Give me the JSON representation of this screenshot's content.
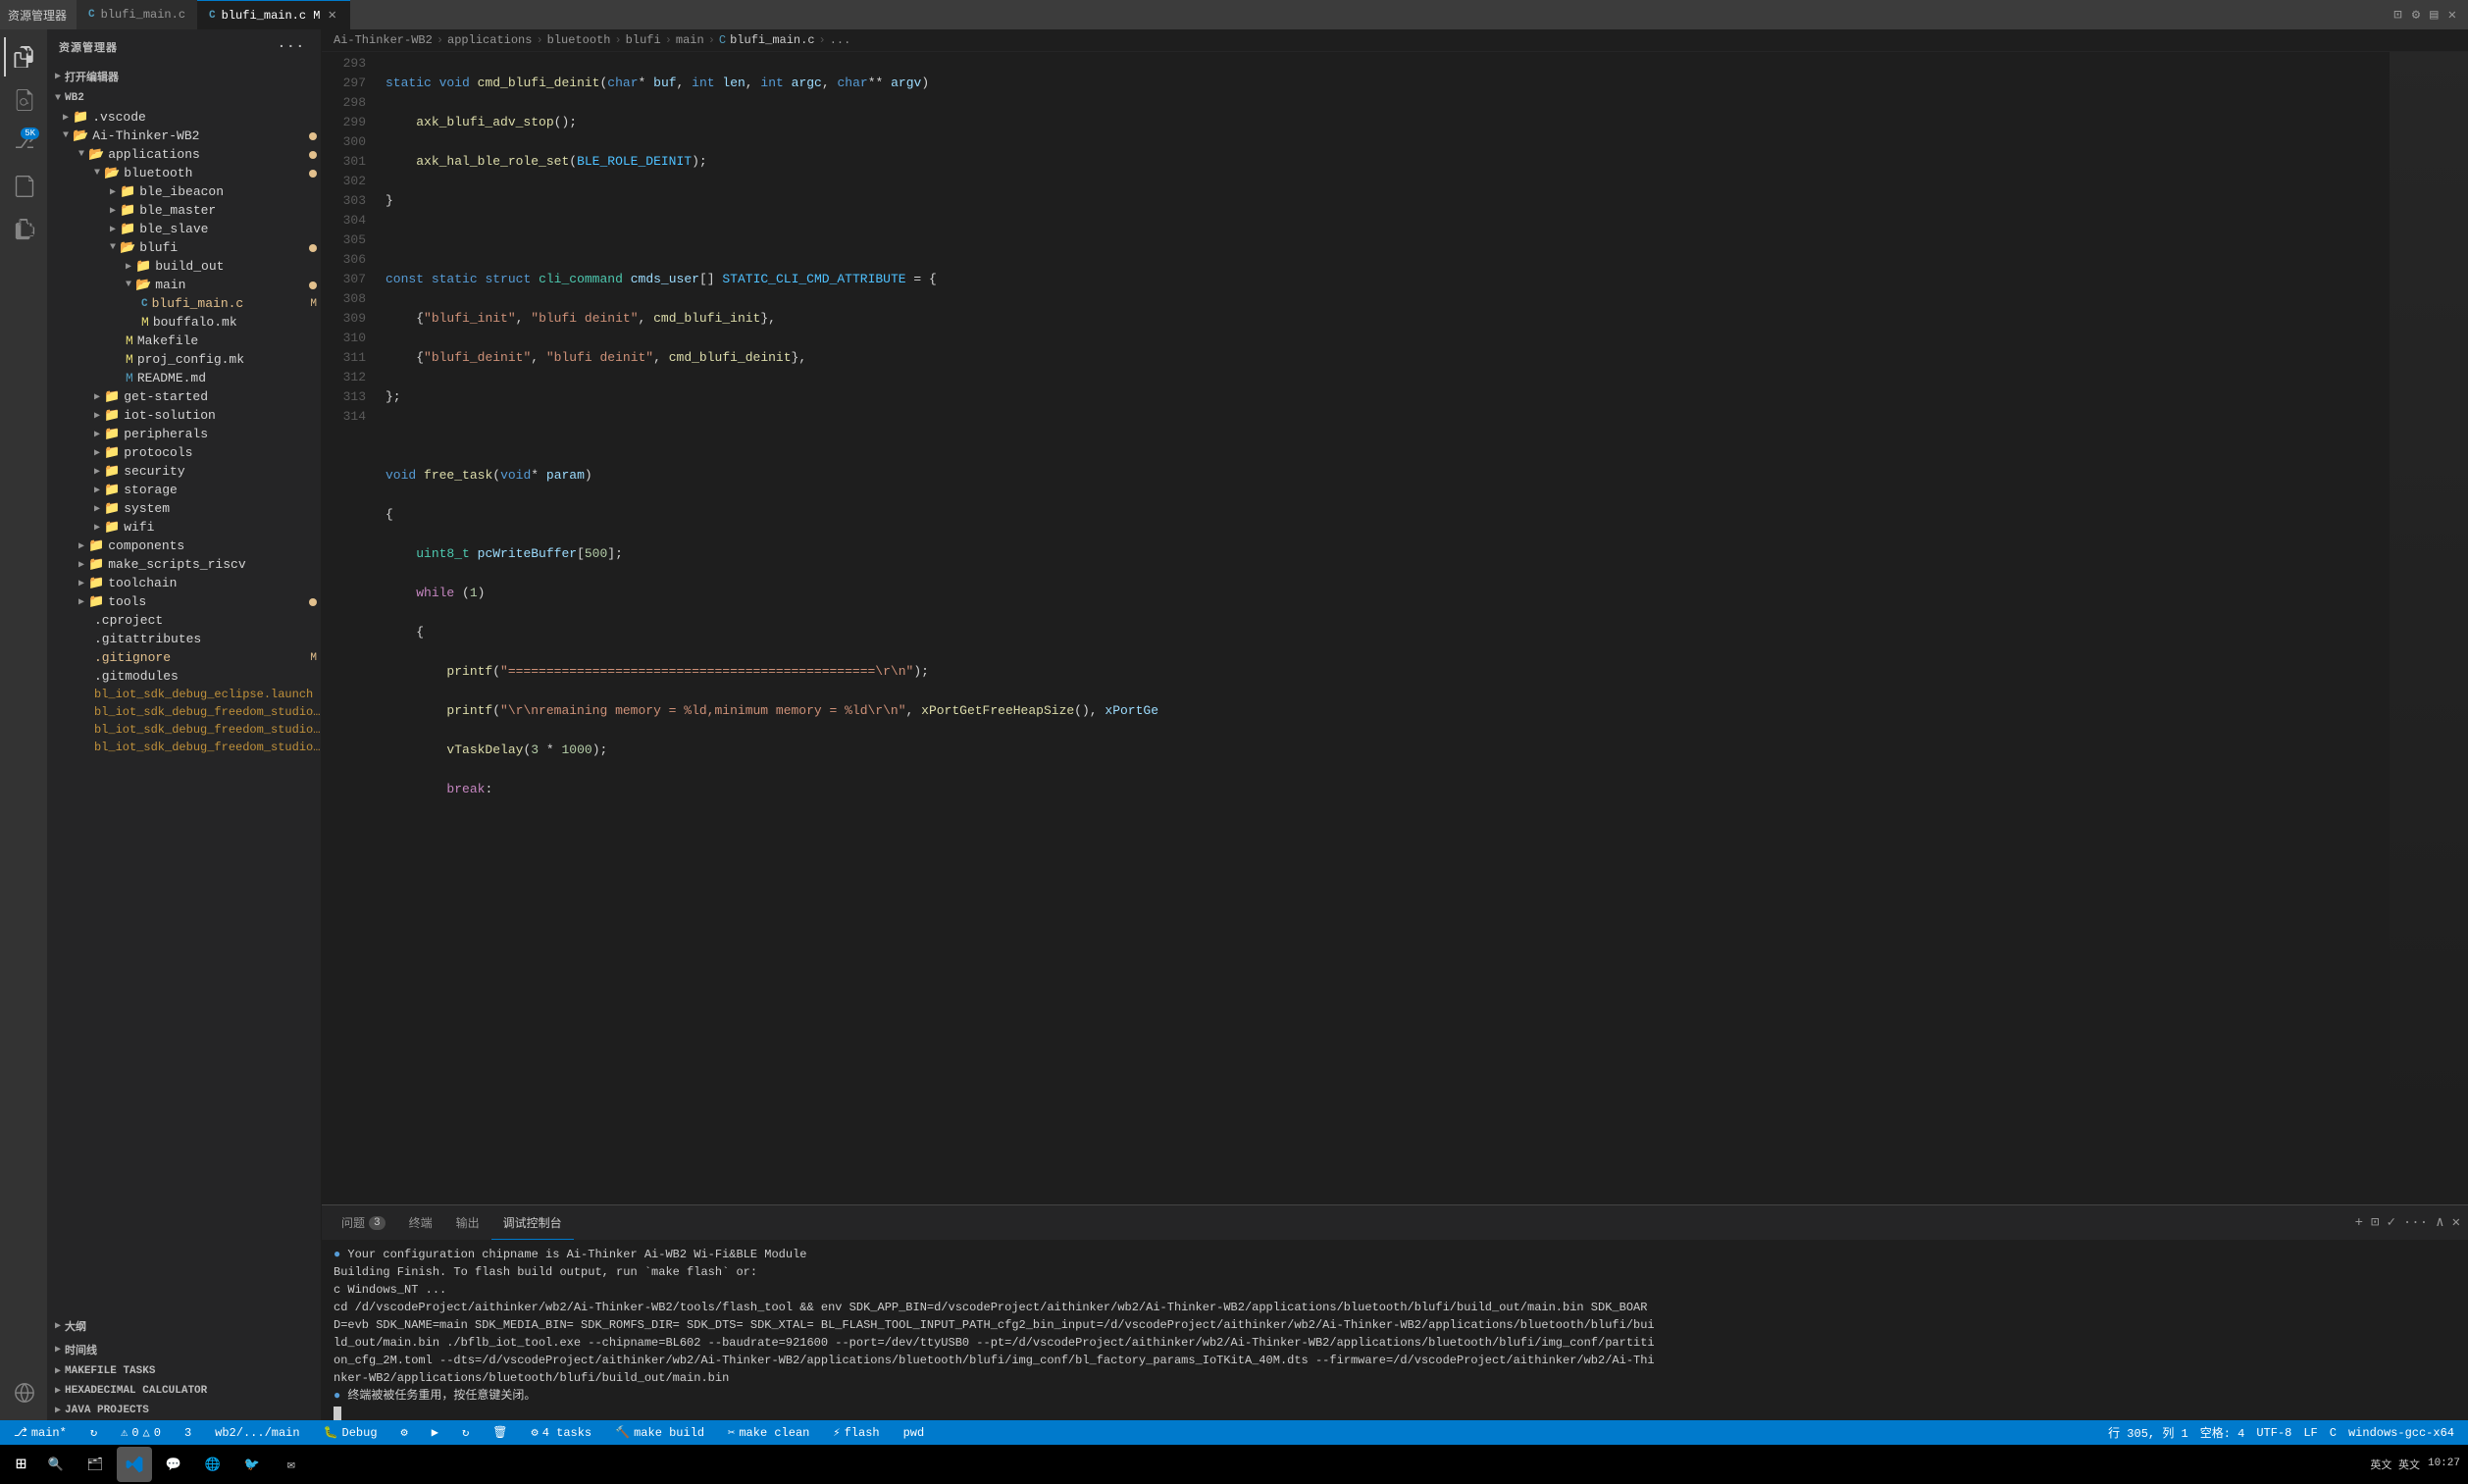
{
  "titleBar": {
    "appName": "资源管理器",
    "openEditor": "打开编辑器",
    "tabs": [
      {
        "id": "blufi_main",
        "label": "blufi_main.c",
        "icon": "C",
        "active": false
      },
      {
        "id": "blufi_main2",
        "label": "blufi_main.c M",
        "icon": "C",
        "active": true
      }
    ]
  },
  "breadcrumb": {
    "items": [
      "Ai-Thinker-WB2",
      "applications",
      "bluetooth",
      "blufi",
      "main",
      "blufi_main.c",
      "..."
    ]
  },
  "sidebar": {
    "title": "资源管理器",
    "rootLabel": "WB2",
    "openEditorLabel": "打开编辑器",
    "tree": [
      {
        "id": "vscode",
        "label": ".vscode",
        "type": "folder",
        "indent": 1,
        "open": false
      },
      {
        "id": "ai-thinker",
        "label": "Ai-Thinker-WB2",
        "type": "folder",
        "indent": 1,
        "open": true,
        "modified": true
      },
      {
        "id": "applications",
        "label": "applications",
        "type": "folder",
        "indent": 2,
        "open": true,
        "modified": true
      },
      {
        "id": "bluetooth",
        "label": "bluetooth",
        "type": "folder",
        "indent": 3,
        "open": true,
        "modified": true
      },
      {
        "id": "ble_ibeacon",
        "label": "ble_ibeacon",
        "type": "folder",
        "indent": 4,
        "open": false
      },
      {
        "id": "ble_master",
        "label": "ble_master",
        "type": "folder",
        "indent": 4,
        "open": false
      },
      {
        "id": "ble_slave",
        "label": "ble_slave",
        "type": "folder",
        "indent": 4,
        "open": false
      },
      {
        "id": "blufi",
        "label": "blufi",
        "type": "folder",
        "indent": 4,
        "open": true,
        "modified": true
      },
      {
        "id": "build_out",
        "label": "build_out",
        "type": "folder",
        "indent": 5,
        "open": false
      },
      {
        "id": "main",
        "label": "main",
        "type": "folder",
        "indent": 5,
        "open": true,
        "modified": true
      },
      {
        "id": "blufi_main_c",
        "label": "blufi_main.c",
        "type": "file-c",
        "indent": 6,
        "modified": "M"
      },
      {
        "id": "bouffalo_mk",
        "label": "bouffalo.mk",
        "type": "file-mk",
        "indent": 6
      },
      {
        "id": "makefile",
        "label": "Makefile",
        "type": "file-mk",
        "indent": 5
      },
      {
        "id": "proj_config_mk",
        "label": "proj_config.mk",
        "type": "file-mk",
        "indent": 5
      },
      {
        "id": "readme_md",
        "label": "README.md",
        "type": "file-md",
        "indent": 5
      },
      {
        "id": "get_started",
        "label": "get-started",
        "type": "folder",
        "indent": 3,
        "open": false
      },
      {
        "id": "iot_solution",
        "label": "iot-solution",
        "type": "folder",
        "indent": 3,
        "open": false
      },
      {
        "id": "peripherals",
        "label": "peripherals",
        "type": "folder",
        "indent": 3,
        "open": false
      },
      {
        "id": "protocols",
        "label": "protocols",
        "type": "folder",
        "indent": 3,
        "open": false
      },
      {
        "id": "security",
        "label": "security",
        "type": "folder",
        "indent": 3,
        "open": false
      },
      {
        "id": "storage",
        "label": "storage",
        "type": "folder",
        "indent": 3,
        "open": false
      },
      {
        "id": "system",
        "label": "system",
        "type": "folder",
        "indent": 3,
        "open": false
      },
      {
        "id": "wifi",
        "label": "wifi",
        "type": "folder",
        "indent": 3,
        "open": false
      },
      {
        "id": "components",
        "label": "components",
        "type": "folder",
        "indent": 2,
        "open": false
      },
      {
        "id": "make_scripts",
        "label": "make_scripts_riscv",
        "type": "folder",
        "indent": 2,
        "open": false
      },
      {
        "id": "toolchain",
        "label": "toolchain",
        "type": "folder",
        "indent": 2,
        "open": false
      },
      {
        "id": "tools",
        "label": "tools",
        "type": "folder",
        "indent": 2,
        "open": false,
        "modified": true
      },
      {
        "id": "cproject",
        "label": ".cproject",
        "type": "file",
        "indent": 2
      },
      {
        "id": "gitattributes",
        "label": ".gitattributes",
        "type": "file",
        "indent": 2
      },
      {
        "id": "gitignore",
        "label": ".gitignore",
        "type": "file",
        "indent": 2,
        "modified": "M"
      },
      {
        "id": "gitmodules",
        "label": ".gitmodules",
        "type": "file",
        "indent": 2
      },
      {
        "id": "bl_iot1",
        "label": "bl_iot_sdk_debug_eclipse.launch",
        "type": "file-launch",
        "indent": 2
      },
      {
        "id": "bl_iot2",
        "label": "bl_iot_sdk_debug_freedom_studio_win_at...",
        "type": "file-launch",
        "indent": 2
      },
      {
        "id": "bl_iot3",
        "label": "bl_iot_sdk_debug_freedom_studio_win_at...",
        "type": "file-launch",
        "indent": 2
      },
      {
        "id": "bl_iot4",
        "label": "bl_iot_sdk_debug_freedom_studio_win_bl...",
        "type": "file-launch",
        "indent": 2
      }
    ],
    "bottomSections": [
      {
        "id": "outline",
        "label": "大纲",
        "open": true
      },
      {
        "id": "timeline",
        "label": "时间线",
        "open": false
      },
      {
        "id": "makefile_tasks",
        "label": "MAKEFILE TASKS",
        "open": false
      },
      {
        "id": "hex_calc",
        "label": "HEXADECIMAL CALCULATOR",
        "open": false
      },
      {
        "id": "java_projects",
        "label": "JAVA PROJECTS",
        "open": false
      }
    ]
  },
  "code": {
    "startLine": 293,
    "lines": [
      {
        "num": 293,
        "text": "static void cmd_blufi_deinit(char* buf, int len, int argc, char** argv)"
      },
      {
        "num": 297,
        "text": "    axk_blufi_adv_stop();"
      },
      {
        "num": 298,
        "text": "    axk_hal_ble_role_set(BLE_ROLE_DEINIT);"
      },
      {
        "num": 299,
        "text": "}"
      },
      {
        "num": 300,
        "text": ""
      },
      {
        "num": 301,
        "text": "const static struct cli_command cmds_user[] STATIC_CLI_CMD_ATTRIBUTE = {"
      },
      {
        "num": 302,
        "text": "    {\"blufi_init\", \"blufi deinit\", cmd_blufi_init},"
      },
      {
        "num": 303,
        "text": "    {\"blufi_deinit\", \"blufi deinit\", cmd_blufi_deinit},"
      },
      {
        "num": 304,
        "text": "};"
      },
      {
        "num": 305,
        "text": ""
      },
      {
        "num": 306,
        "text": "void free_task(void* param)"
      },
      {
        "num": 307,
        "text": "{"
      },
      {
        "num": 308,
        "text": "    uint8_t pcWriteBuffer[500];"
      },
      {
        "num": 309,
        "text": "    while (1)"
      },
      {
        "num": 310,
        "text": "    {"
      },
      {
        "num": 311,
        "text": "        printf(\"================================================\\r\\n\");"
      },
      {
        "num": 312,
        "text": "        printf(\"\\r\\nremaining memory = %ld,minimum memory = %ld\\r\\n\", xPortGetFreeHeapSize(), xPortGe"
      },
      {
        "num": 313,
        "text": "        vTaskDelay(3 * 1000);"
      },
      {
        "num": 314,
        "text": "        break;"
      }
    ]
  },
  "panel": {
    "tabs": [
      {
        "id": "problems",
        "label": "问题",
        "badge": "3",
        "active": false
      },
      {
        "id": "debug",
        "label": "终端",
        "active": false
      },
      {
        "id": "output",
        "label": "输出",
        "active": false
      },
      {
        "id": "terminal",
        "label": "调试控制台",
        "active": true
      }
    ],
    "terminalLines": [
      "● Your configuration chipname is Ai-Thinker Ai-WB2 Wi-Fi&BLE Module",
      "Building Finish. To flash build output, run `make flash` or:",
      "c Windows_NT ...",
      "cd /d/vscodeProject/aithinker/wb2/Ai-Thinker-WB2/tools/flash_tool && env SDK_APP_BIN=d/vscodeProject/aithinker/wb2/Ai-Thinker-WB2/applications/bluetooth/blufi/build_out/main.bin SDK_BOAR",
      "D=evb SDK_NAME=main SDK_MEDIA_BIN= SDK_ROMFS_DIR= SDK_DTS= SDK_XTAL= BL_FLASH_TOOL_INPUT_PATH_cfg2_bin_input=/d/vscodeProject/aithinker/wb2/Ai-Thinker-WB2/applications/bluetooth/blufi/bui",
      "ld_out/main.bin ./bflb_iot_tool.exe --chipname=BL602 --baudrate=921600 --port=/dev/ttyUSB0 --pt=/d/vscodeProject/aithinker/wb2/Ai-Thinker-WB2/applications/bluetooth/blufi/img_conf/partiti",
      "on_cfg_2M.toml --dts=/d/vscodeProject/aithinker/wb2/Ai-Thinker-WB2/applications/bluetooth/blufi/img_conf/bl_factory_params_IoTKitA_40M.dts --firmware=/d/vscodeProject/aithinker/wb2/Ai-Thi",
      "nker-WB2/applications/bluetooth/blufi/build_out/main.bin",
      "● 终端被被任务重用，按任意键关闭。"
    ]
  },
  "statusBar": {
    "branch": "main*",
    "sync": "↻",
    "errors": "⓪ 0",
    "warnings": "△ 0",
    "info": "3",
    "wb2": "wb2/.../main",
    "debug": "Debug",
    "gear": "⚙",
    "play": "▶",
    "refresh": "↻",
    "trash": "🗑",
    "tasks": "4 tasks",
    "makeBuild": "make build",
    "makeClean": "make clean",
    "flash": "flash",
    "pwd": "pwd",
    "rowCol": "行 305, 列 1",
    "spaces": "空格: 4",
    "encoding": "UTF-8",
    "lineEnding": "LF",
    "language": "C",
    "compiler": "windows-gcc-x64"
  },
  "taskbar": {
    "time": "10:27",
    "date": "英文 英文",
    "icons": [
      "⊞",
      "🔍",
      "🗂",
      "💬",
      "🌐",
      "🐦",
      "✉"
    ]
  }
}
